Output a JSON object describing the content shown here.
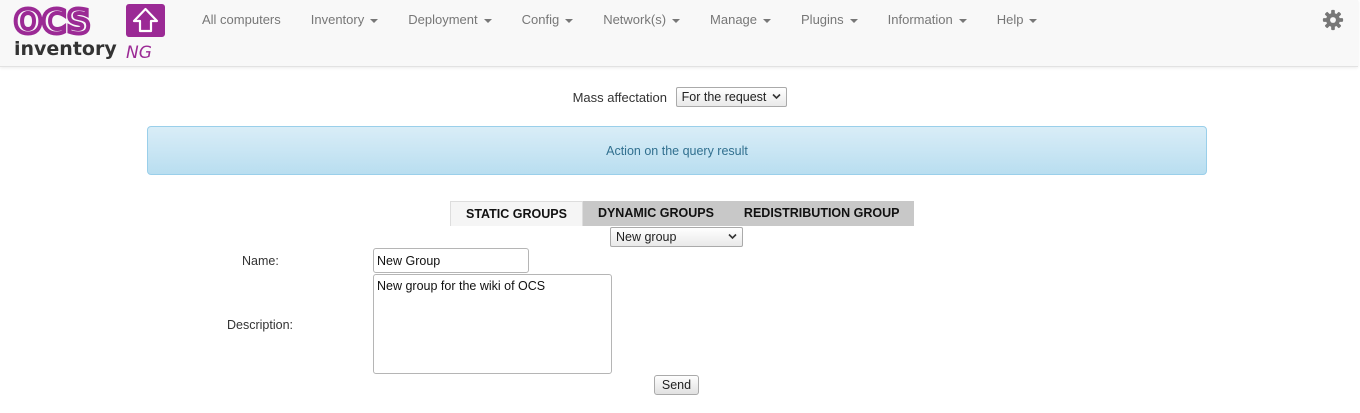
{
  "logo": {
    "top_text": "OCS",
    "bottom_text": "inventory",
    "suffix": "NG"
  },
  "nav": {
    "items": [
      {
        "label": "All computers",
        "dropdown": false
      },
      {
        "label": "Inventory",
        "dropdown": true
      },
      {
        "label": "Deployment",
        "dropdown": true
      },
      {
        "label": "Config",
        "dropdown": true
      },
      {
        "label": "Network(s)",
        "dropdown": true
      },
      {
        "label": "Manage",
        "dropdown": true
      },
      {
        "label": "Plugins",
        "dropdown": true
      },
      {
        "label": "Information",
        "dropdown": true
      },
      {
        "label": "Help",
        "dropdown": true
      }
    ],
    "settings_icon": "gear-icon"
  },
  "mass": {
    "label": "Mass affectation",
    "selected": "For the request"
  },
  "alert": {
    "text": "Action on the query result"
  },
  "tabs": [
    {
      "label": "STATIC GROUPS",
      "active": true
    },
    {
      "label": "DYNAMIC GROUPS",
      "active": false
    },
    {
      "label": "REDISTRIBUTION GROUP",
      "active": false
    }
  ],
  "group_select": {
    "selected": "New group"
  },
  "form": {
    "name_label": "Name:",
    "name_value": "New Group",
    "description_label": "Description:",
    "description_value": "New group for the wiki of OCS",
    "send_label": "Send"
  },
  "colors": {
    "brand": "#9b2a95",
    "alert_bg": "#d9edf7",
    "alert_text": "#31708f"
  }
}
